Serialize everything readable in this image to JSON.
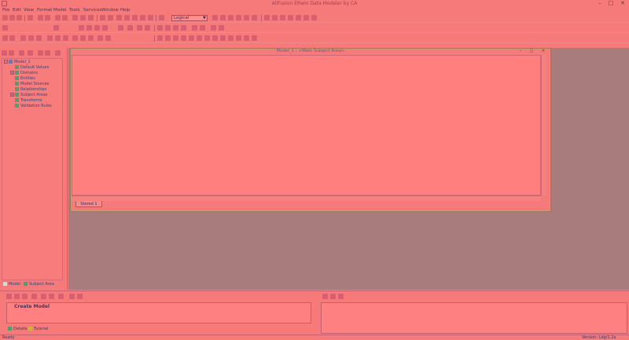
{
  "window": {
    "title": "AllFusion ERwin Data Modeler by CA",
    "minimize": "–",
    "maximize": "□",
    "close": "✕"
  },
  "menubar": [
    "File",
    "Edit",
    "View",
    "Format",
    "Model",
    "Tools",
    "Services",
    "Window",
    "Help"
  ],
  "toolbar": {
    "view_select": "Logical"
  },
  "model_tree": {
    "root": "Model_1",
    "items": [
      "Default Values",
      "Domains",
      "Entities",
      "Model Sources",
      "Relationships",
      "Subject Areas",
      "Transforms",
      "Validation Rules"
    ]
  },
  "left_tabs": [
    "Model",
    "Subject Area"
  ],
  "diagram": {
    "title": "Model_1 : <Main Subject Area>",
    "stored_tab": "Stored 1"
  },
  "action_log": {
    "item": "Create Model"
  },
  "bottom_tabs": [
    "Details",
    "Tutorial"
  ],
  "status": {
    "left": "Ready",
    "right": "Version: Ldg/1.2a"
  },
  "colors": {
    "accent": "#f77a7a",
    "workspace": "#a87c7c"
  }
}
